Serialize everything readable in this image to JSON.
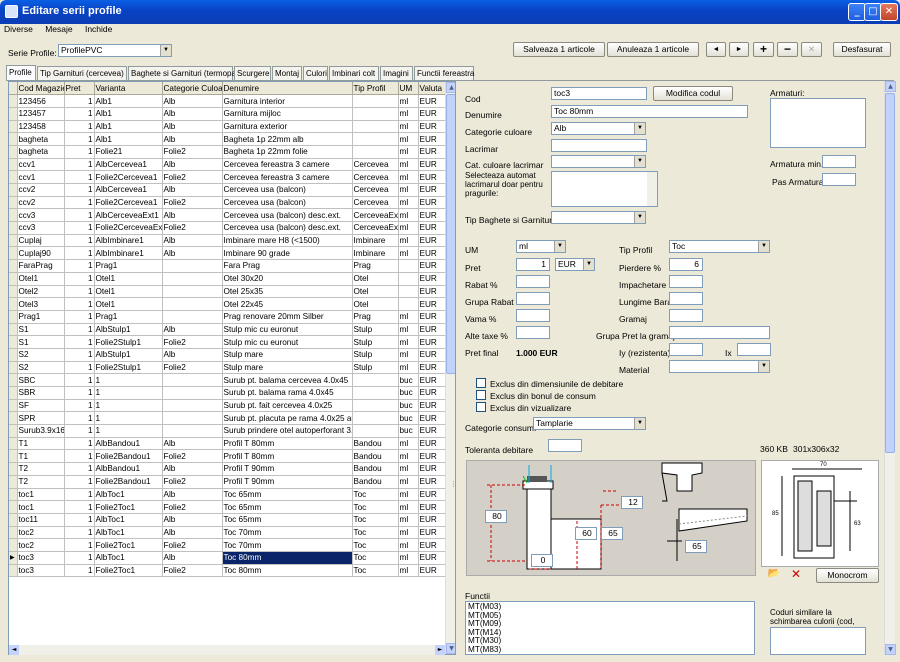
{
  "window": {
    "title": "Editare serii profile"
  },
  "menu": [
    "Diverse",
    "Mesaje",
    "Inchide"
  ],
  "serie": {
    "label": "Serie Profile:",
    "value": "ProfilePVC"
  },
  "toolbar": {
    "save": "Salveaza 1 articole",
    "cancel": "Anuleaza 1 articole",
    "nav_prev": "◄",
    "nav_next": "►",
    "add": "+",
    "remove": "−",
    "delete": "✕",
    "expand": "Desfasurat"
  },
  "tabs": [
    "Profile",
    "Tip Garnituri (cercevea)",
    "Baghete si Garnituri (termopan)",
    "Scurgere",
    "Montaj",
    "Culori",
    "Imbinari colt",
    "Imagini",
    "Functii fereastra"
  ],
  "grid": {
    "columns": [
      "Cod Magazie",
      "Pret",
      "Varianta",
      "Categorie Culoare",
      "Denumire",
      "Tip Profil",
      "UM",
      "Valuta"
    ],
    "rows": [
      [
        "123456",
        "1",
        "Alb1",
        "Alb",
        "Garnitura interior",
        "",
        "ml",
        "EUR"
      ],
      [
        "123457",
        "1",
        "Alb1",
        "Alb",
        "Garnitura mijloc",
        "",
        "ml",
        "EUR"
      ],
      [
        "123458",
        "1",
        "Alb1",
        "Alb",
        "Garnitura exterior",
        "",
        "ml",
        "EUR"
      ],
      [
        "bagheta",
        "1",
        "Alb1",
        "Alb",
        "Bagheta 1p 22mm alb",
        "",
        "ml",
        "EUR"
      ],
      [
        "bagheta",
        "1",
        "Folie21",
        "Folie2",
        "Bagheta 1p 22mm folie",
        "",
        "ml",
        "EUR"
      ],
      [
        "ccv1",
        "1",
        "AlbCercevea1",
        "Alb",
        "Cercevea fereastra 3 camere",
        "Cercevea",
        "ml",
        "EUR"
      ],
      [
        "ccv1",
        "1",
        "Folie2Cercevea1",
        "Folie2",
        "Cercevea fereastra 3 camere",
        "Cercevea",
        "ml",
        "EUR"
      ],
      [
        "ccv2",
        "1",
        "AlbCercevea1",
        "Alb",
        "Cercevea usa (balcon)",
        "Cercevea",
        "ml",
        "EUR"
      ],
      [
        "ccv2",
        "1",
        "Folie2Cercevea1",
        "Folie2",
        "Cercevea usa (balcon)",
        "Cercevea",
        "ml",
        "EUR"
      ],
      [
        "ccv3",
        "1",
        "AlbCerceveaExt1",
        "Alb",
        "Cercevea usa (balcon) desc.ext.",
        "CerceveaExt",
        "ml",
        "EUR"
      ],
      [
        "ccv3",
        "1",
        "Folie2CerceveaExt1",
        "Folie2",
        "Cercevea usa (balcon) desc.ext.",
        "CerceveaExt",
        "ml",
        "EUR"
      ],
      [
        "Cuplaj",
        "1",
        "AlbImbinare1",
        "Alb",
        "Imbinare mare H8 (<1500)",
        "Imbinare",
        "ml",
        "EUR"
      ],
      [
        "Cuplaj90",
        "1",
        "AlbImbinare1",
        "Alb",
        "Imbinare 90 grade",
        "Imbinare",
        "ml",
        "EUR"
      ],
      [
        "FaraPrag",
        "1",
        "Prag1",
        "",
        "Fara Prag",
        "Prag",
        "",
        "EUR"
      ],
      [
        "Otel1",
        "1",
        "Otel1",
        "",
        "Otel 30x20",
        "Otel",
        "",
        "EUR"
      ],
      [
        "Otel2",
        "1",
        "Otel1",
        "",
        "Otel 25x35",
        "Otel",
        "",
        "EUR"
      ],
      [
        "Otel3",
        "1",
        "Otel1",
        "",
        "Otel 22x45",
        "Otel",
        "",
        "EUR"
      ],
      [
        "Prag1",
        "1",
        "Prag1",
        "",
        "Prag renovare 20mm Silber",
        "Prag",
        "ml",
        "EUR"
      ],
      [
        "S1",
        "1",
        "AlbStulp1",
        "Alb",
        "Stulp mic cu euronut",
        "Stulp",
        "ml",
        "EUR"
      ],
      [
        "S1",
        "1",
        "Folie2Stulp1",
        "Folie2",
        "Stulp mic cu euronut",
        "Stulp",
        "ml",
        "EUR"
      ],
      [
        "S2",
        "1",
        "AlbStulp1",
        "Alb",
        "Stulp mare",
        "Stulp",
        "ml",
        "EUR"
      ],
      [
        "S2",
        "1",
        "Folie2Stulp1",
        "Folie2",
        "Stulp mare",
        "Stulp",
        "ml",
        "EUR"
      ],
      [
        "SBC",
        "1",
        "1",
        "",
        "Surub pt. balama cercevea 4.0x45",
        "",
        "buc",
        "EUR"
      ],
      [
        "SBR",
        "1",
        "1",
        "",
        "Surub pt. balama rama 4.0x45",
        "",
        "buc",
        "EUR"
      ],
      [
        "SF",
        "1",
        "1",
        "",
        "Surub pt. fait cercevea 4.0x25",
        "",
        "buc",
        "EUR"
      ],
      [
        "SPR",
        "1",
        "1",
        "",
        "Surub pt. placuta pe rama 4.0x25 auto",
        "",
        "buc",
        "EUR"
      ],
      [
        "Surub3.9x16",
        "1",
        "1",
        "",
        "Surub prindere otel autoperforant 3.9x16",
        "",
        "buc",
        "EUR"
      ],
      [
        "T1",
        "1",
        "AlbBandou1",
        "Alb",
        "Profil T 80mm",
        "Bandou",
        "ml",
        "EUR"
      ],
      [
        "T1",
        "1",
        "Folie2Bandou1",
        "Folie2",
        "Profil T 80mm",
        "Bandou",
        "ml",
        "EUR"
      ],
      [
        "T2",
        "1",
        "AlbBandou1",
        "Alb",
        "Profil T 90mm",
        "Bandou",
        "ml",
        "EUR"
      ],
      [
        "T2",
        "1",
        "Folie2Bandou1",
        "Folie2",
        "Profil T 90mm",
        "Bandou",
        "ml",
        "EUR"
      ],
      [
        "toc1",
        "1",
        "AlbToc1",
        "Alb",
        "Toc 65mm",
        "Toc",
        "ml",
        "EUR"
      ],
      [
        "toc1",
        "1",
        "Folie2Toc1",
        "Folie2",
        "Toc 65mm",
        "Toc",
        "ml",
        "EUR"
      ],
      [
        "toc11",
        "1",
        "AlbToc1",
        "Alb",
        "Toc 65mm",
        "Toc",
        "ml",
        "EUR"
      ],
      [
        "toc2",
        "1",
        "AlbToc1",
        "Alb",
        "Toc 70mm",
        "Toc",
        "ml",
        "EUR"
      ],
      [
        "toc2",
        "1",
        "Folie2Toc1",
        "Folie2",
        "Toc 70mm",
        "Toc",
        "ml",
        "EUR"
      ],
      [
        "toc3",
        "1",
        "AlbToc1",
        "Alb",
        "Toc 80mm",
        "Toc",
        "ml",
        "EUR"
      ],
      [
        "toc3",
        "1",
        "Folie2Toc1",
        "Folie2",
        "Toc 80mm",
        "Toc",
        "ml",
        "EUR"
      ]
    ],
    "selected_index": 36
  },
  "form": {
    "cod_label": "Cod",
    "cod_value": "toc3",
    "modifica_btn": "Modifica codul",
    "denumire_label": "Denumire",
    "denumire_value": "Toc 80mm",
    "categorie_label": "Categorie culoare",
    "categorie_value": "Alb",
    "lacrimar_label": "Lacrimar",
    "cat_lacrimar_label": "Cat. culoare lacrimar",
    "selecteaza_label": "Selecteaza automat lacrimarul doar pentru pragurile:",
    "tip_baghete_label": "Tip Baghete si Garnituri",
    "armaturi_label": "Armaturi:",
    "armatura_min_label": "Armatura min.:",
    "pas_armatura_label": "Pas Armatura:",
    "um_label": "UM",
    "um_value": "ml",
    "tip_profil_label": "Tip Profil",
    "tip_profil_value": "Toc",
    "pret_label": "Pret",
    "pret_value": "1",
    "valuta_value": "EUR",
    "pierdere_label": "Pierdere %",
    "pierdere_value": "6",
    "rabat_label": "Rabat %",
    "impachetare_label": "Impachetare",
    "grupa_rabat_label": "Grupa Rabat",
    "lungime_bara_label": "Lungime Bara",
    "vama_label": "Vama %",
    "gramaj_label": "Gramaj",
    "alte_taxe_label": "Alte taxe %",
    "grupa_pret_label": "Grupa Pret la gramaj",
    "pret_final_label": "Pret final",
    "pret_final_value": "1.000 EUR",
    "iy_label": "Iy (rezistenta)",
    "ix_label": "Ix",
    "material_label": "Material",
    "exclus1": "Exclus din dimensiunile de debitare",
    "exclus2": "Exclus din bonul de consum",
    "exclus3": "Exclus din vizualizare",
    "categorie_consum_label": "Categorie consum:",
    "categorie_consum_value": "Tamplarie",
    "toleranta_label": "Toleranta debitare",
    "image_size": "360 KB",
    "image_dims": "301x306x32",
    "monocrom": "Monocrom",
    "functii_label": "Functii",
    "functii": [
      "MT(M03)",
      "MT(M05)",
      "MT(M09)",
      "MT(M14)",
      "MT(M30)",
      "MT(M83)"
    ],
    "coduri_label": "Coduri similare la schimbarea culorii (cod, varianta):",
    "dims": {
      "d80": "80",
      "d12": "12",
      "d60": "60",
      "d65a": "65",
      "d0": "0",
      "d65b": "65"
    },
    "thumb_dims": {
      "w70": "70",
      "h85": "85",
      "h63": "63"
    }
  },
  "colors": {
    "accent": "#0a246a",
    "titlebar": "#0842c4"
  }
}
